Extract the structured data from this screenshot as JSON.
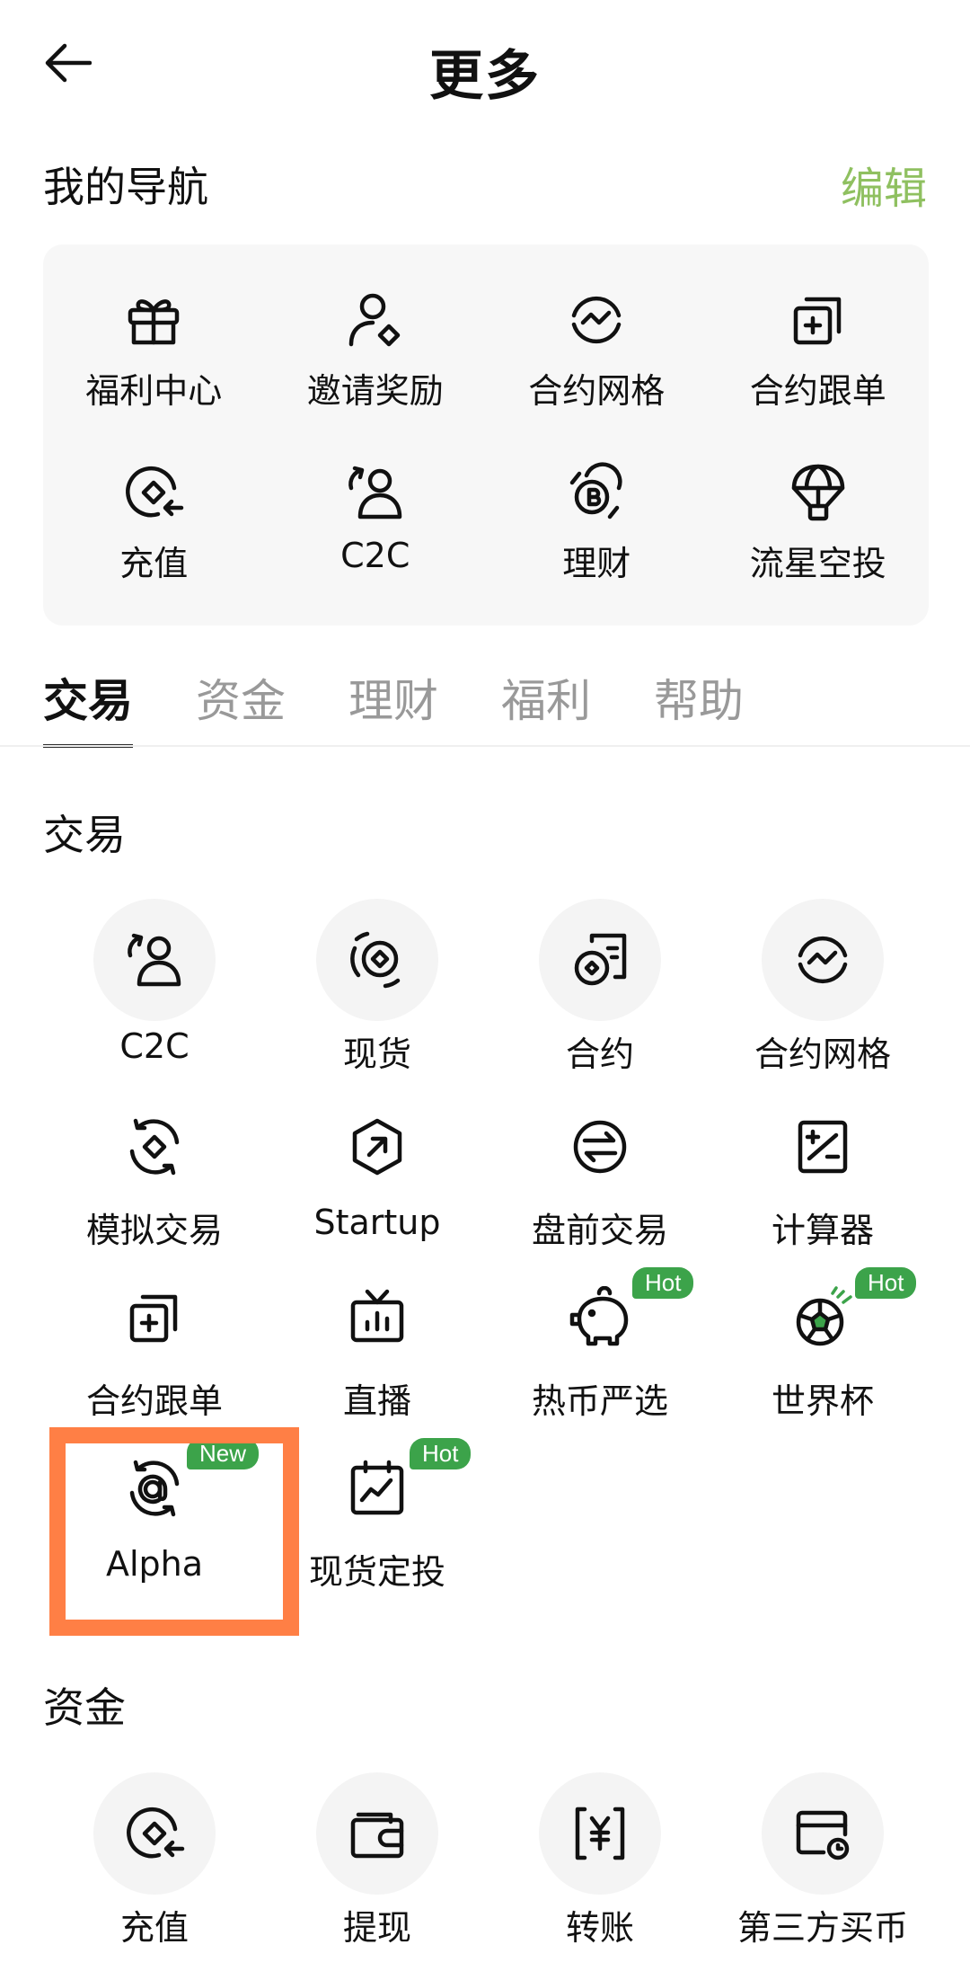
{
  "header": {
    "title": "更多"
  },
  "my_nav": {
    "title": "我的导航",
    "edit_label": "编辑",
    "items": [
      {
        "label": "福利中心",
        "icon": "gift-icon"
      },
      {
        "label": "邀请奖励",
        "icon": "invite-user-icon"
      },
      {
        "label": "合约网格",
        "icon": "grid-wave-icon"
      },
      {
        "label": "合约跟单",
        "icon": "copy-plus-icon"
      },
      {
        "label": "充值",
        "icon": "deposit-icon"
      },
      {
        "label": "C2C",
        "icon": "c2c-icon"
      },
      {
        "label": "理财",
        "icon": "finance-coin-icon"
      },
      {
        "label": "流星空投",
        "icon": "parachute-icon"
      }
    ]
  },
  "tabs": [
    "交易",
    "资金",
    "理财",
    "福利",
    "帮助"
  ],
  "active_tab": "交易",
  "trade_section": {
    "title": "交易",
    "items": [
      {
        "label": "C2C",
        "icon": "c2c-icon"
      },
      {
        "label": "现货",
        "icon": "spot-icon"
      },
      {
        "label": "合约",
        "icon": "futures-icon"
      },
      {
        "label": "合约网格",
        "icon": "grid-wave-icon"
      },
      {
        "label": "模拟交易",
        "icon": "demo-trade-icon"
      },
      {
        "label": "Startup",
        "icon": "startup-icon"
      },
      {
        "label": "盘前交易",
        "icon": "premarket-icon"
      },
      {
        "label": "计算器",
        "icon": "calculator-icon"
      },
      {
        "label": "合约跟单",
        "icon": "copy-plus-icon"
      },
      {
        "label": "直播",
        "icon": "live-tv-icon"
      },
      {
        "label": "热币严选",
        "icon": "piggy-bank-icon",
        "badge": "Hot"
      },
      {
        "label": "世界杯",
        "icon": "football-icon",
        "badge": "Hot"
      },
      {
        "label": "Alpha",
        "icon": "alpha-icon",
        "badge": "New"
      },
      {
        "label": "现货定投",
        "icon": "calendar-chart-icon",
        "badge": "Hot"
      }
    ]
  },
  "funds_section": {
    "title": "资金",
    "items": [
      {
        "label": "充值",
        "icon": "deposit-icon"
      },
      {
        "label": "提现",
        "icon": "wallet-icon"
      },
      {
        "label": "转账",
        "icon": "transfer-yen-icon"
      },
      {
        "label": "第三方买币",
        "icon": "card-buy-icon"
      }
    ]
  },
  "colors": {
    "accent_green": "#8fc060",
    "badge_green": "#3ca34a",
    "highlight_orange": "#ff7f45"
  }
}
